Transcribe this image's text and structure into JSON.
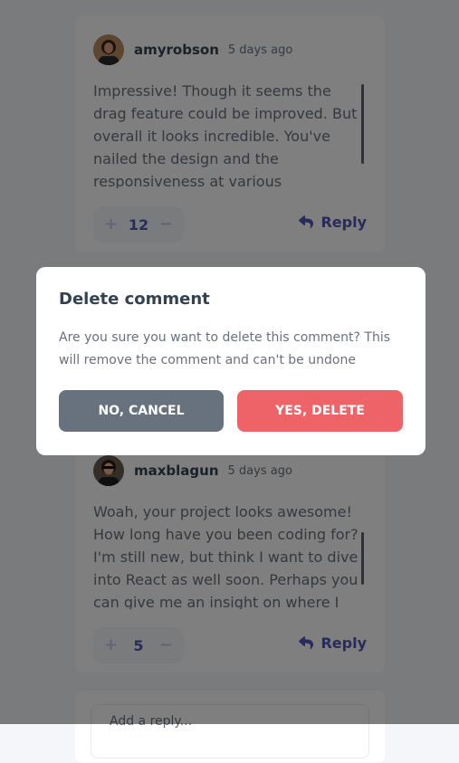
{
  "comments": [
    {
      "username": "amyrobson",
      "timestamp": "5 days ago",
      "text": "Impressive! Though it seems the drag feature could be improved. But overall it looks incredible. You've nailed the design and the responsiveness at various breakpoints works really well.",
      "score": "12",
      "reply_label": "Reply"
    },
    {
      "username": "maxblagun",
      "timestamp": "5 days ago",
      "text": "Woah, your project looks awesome! How long have you been coding for? I'm still new, but think I want to dive into React as well soon. Perhaps you can give me an insight on where I can learn React?",
      "score": "5",
      "reply_label": "Reply"
    }
  ],
  "vote": {
    "plus": "+",
    "minus": "−"
  },
  "reply_box": {
    "placeholder": "Add a reply..."
  },
  "modal": {
    "title": "Delete comment",
    "text": "Are you sure you want to delete this comment? This will remove the comment and can't be undone",
    "cancel_label": "NO, CANCEL",
    "delete_label": "YES, DELETE"
  },
  "icons": {
    "reply": "reply-icon",
    "avatar": "avatar"
  },
  "colors": {
    "primary": "#5357b6",
    "danger": "#ed6368",
    "neutral": "#67727e",
    "dark_text": "#334253",
    "background": "#f5f6fa"
  }
}
